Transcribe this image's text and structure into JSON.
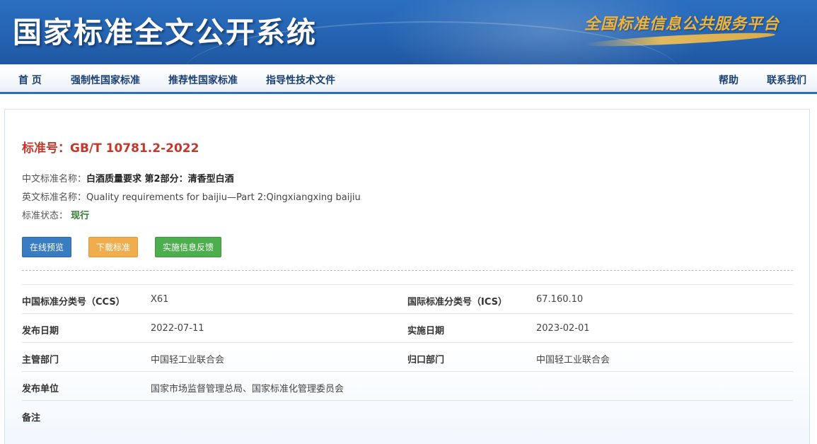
{
  "header": {
    "site_title": "国家标准全文公开系统",
    "platform_slogan": "全国标准信息公共服务平台"
  },
  "nav": {
    "items": [
      "首 页",
      "强制性国家标准",
      "推荐性国家标准",
      "指导性技术文件"
    ],
    "help": "帮助",
    "contact": "联系我们"
  },
  "standard": {
    "number_label": "标准号：",
    "number": "GB/T 10781.2-2022",
    "cn_name_label": "中文标准名称：",
    "cn_name": "白酒质量要求 第2部分：清香型白酒",
    "en_name_label": "英文标准名称：",
    "en_name": "Quality requirements for baijiu—Part 2:Qingxiangxing baijiu",
    "status_label": "标准状态：",
    "status": "现行"
  },
  "buttons": {
    "preview": "在线预览",
    "download": "下载标准",
    "feedback": "实施信息反馈"
  },
  "details": {
    "ccs_label": "中国标准分类号（CCS）",
    "ccs_value": "X61",
    "ics_label": "国际标准分类号（ICS）",
    "ics_value": "67.160.10",
    "publish_date_label": "发布日期",
    "publish_date": "2022-07-11",
    "implement_date_label": "实施日期",
    "implement_date": "2023-02-01",
    "dept_label": "主管部门",
    "dept_value": "中国轻工业联合会",
    "centralized_label": "归口部门",
    "centralized_value": "中国轻工业联合会",
    "publisher_label": "发布单位",
    "publisher_value": "国家市场监督管理总局、国家标准化管理委员会",
    "remark_label": "备注",
    "remark_value": ""
  },
  "colors": {
    "banner_blue": "#2a6fc0",
    "standard_number_red": "#c0392b",
    "status_green": "#2e7d32",
    "btn_preview": "#3a7cc2",
    "btn_download": "#f0ad4e",
    "btn_feedback": "#4cae4c"
  }
}
